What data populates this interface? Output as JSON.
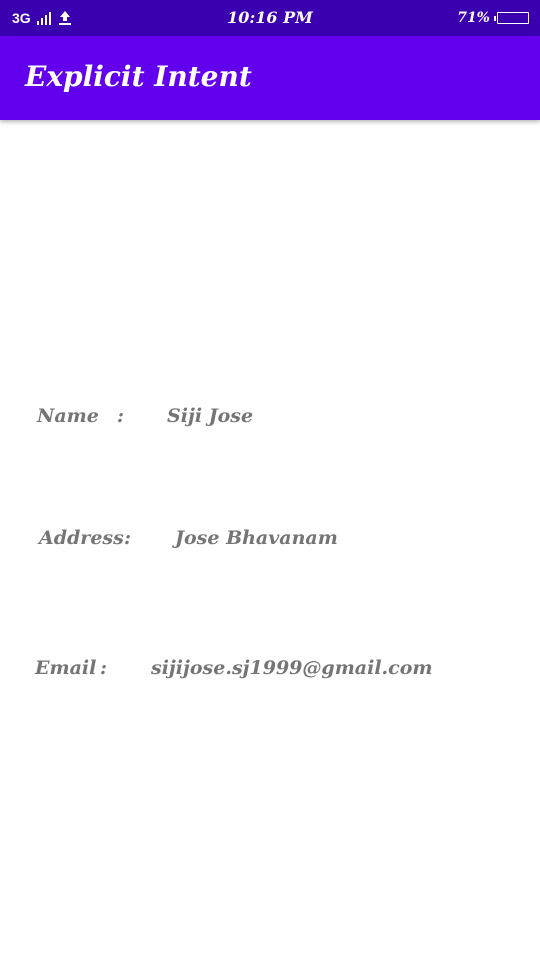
{
  "status_bar": {
    "network_type": "3G",
    "time": "10:16 PM",
    "battery_percent": "71%",
    "icons": [
      "signal-icon",
      "upload-icon",
      "battery-icon"
    ]
  },
  "app_bar": {
    "title": "Explicit Intent"
  },
  "fields": [
    {
      "label": "Name",
      "separator": ":",
      "value": "Siji Jose"
    },
    {
      "label": "Address",
      "separator": ":",
      "value": "Jose Bhavanam"
    },
    {
      "label": "Email",
      "separator": ":",
      "value": "sijijose.sj1999@gmail.com"
    }
  ],
  "colors": {
    "status_bar": "#3a00b0",
    "app_bar": "#6200ee",
    "text": "#757575",
    "background": "#ffffff"
  }
}
